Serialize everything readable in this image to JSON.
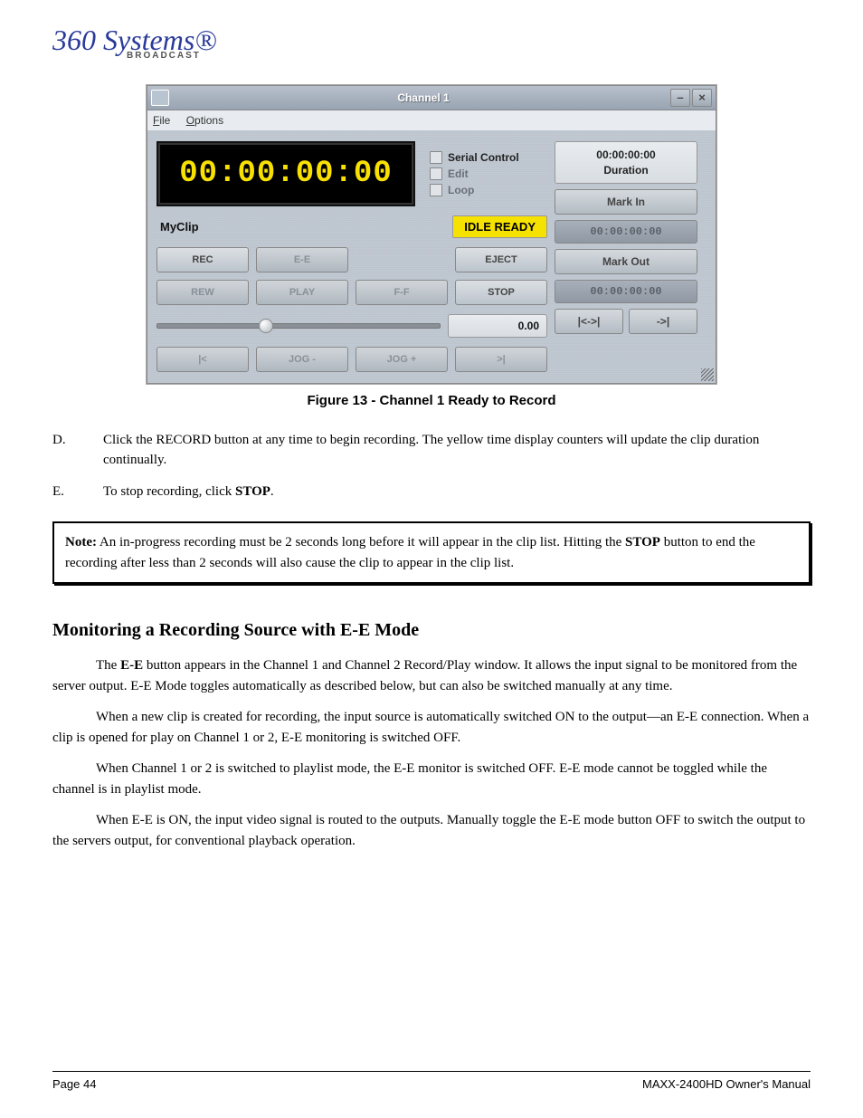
{
  "logo": {
    "line1": "360 Systems",
    "line2": "BROADCAST"
  },
  "window": {
    "title": "Channel  1",
    "minimize": "–",
    "close": "×",
    "menu": {
      "file": "File",
      "options": "Options"
    },
    "lcd_time": "00:00:00:00",
    "checks": {
      "serial": "Serial Control",
      "edit": "Edit",
      "loop": "Loop"
    },
    "clip_name": "MyClip",
    "status": "IDLE READY",
    "transport": {
      "rec": "REC",
      "ee": "E-E",
      "eject": "EJECT",
      "rew": "REW",
      "play": "PLAY",
      "ff": "F-F",
      "stop": "STOP"
    },
    "position": "0.00",
    "jog": {
      "start": "|<",
      "jog_minus": "JOG -",
      "jog_plus": "JOG +",
      "end": ">|"
    },
    "side": {
      "tc": "00:00:00:00",
      "duration_label": "Duration",
      "mark_in_btn": "Mark In",
      "mark_in_val": "00:00:00:00",
      "mark_out_btn": "Mark Out",
      "mark_out_val": "00:00:00:00",
      "range_left": "|<->|",
      "range_right": "->|"
    }
  },
  "figure_caption": "Figure 13 - Channel 1 Ready to Record",
  "instructions": {
    "d": {
      "marker": "D.",
      "text": "Click the RECORD button at any time to begin recording. The yellow time display counters will update the clip duration continually."
    },
    "e": {
      "marker": "E.",
      "prefix": "To stop recording, click ",
      "bold": "STOP",
      "suffix": "."
    }
  },
  "note": {
    "label": "Note:",
    "before_stop": " An in-progress recording must be 2 seconds long before it will appear in the clip list. Hitting the ",
    "stop": "STOP",
    "after_stop": " button to end the recording after less than 2 seconds will also cause the clip to appear in the clip list."
  },
  "section": {
    "heading": "Monitoring a Recording Source with E-E Mode",
    "p1": {
      "prefix": "The ",
      "bold": "E-E",
      "suffix": " button appears in the Channel 1 and Channel 2 Record/Play window. It allows the input signal to be monitored from the server output.  E-E Mode toggles automatically as described below, but can also be switched manually at any time."
    },
    "p2": "When a new clip is created for recording, the input source is automatically switched ON to the output—an E-E connection.  When a clip is opened for play on Channel 1 or 2, E-E monitoring is switched OFF.",
    "p3": "When Channel 1 or 2 is switched to playlist mode, the E-E monitor is switched OFF.  E-E mode cannot be toggled while the channel is in playlist mode.",
    "p4": "When E-E is ON, the input video signal is routed to the outputs.  Manually toggle the E-E mode button OFF to switch the output to the servers output, for conventional playback operation."
  },
  "footer": {
    "left": "Page 44",
    "right": "MAXX-2400HD Owner's Manual"
  }
}
